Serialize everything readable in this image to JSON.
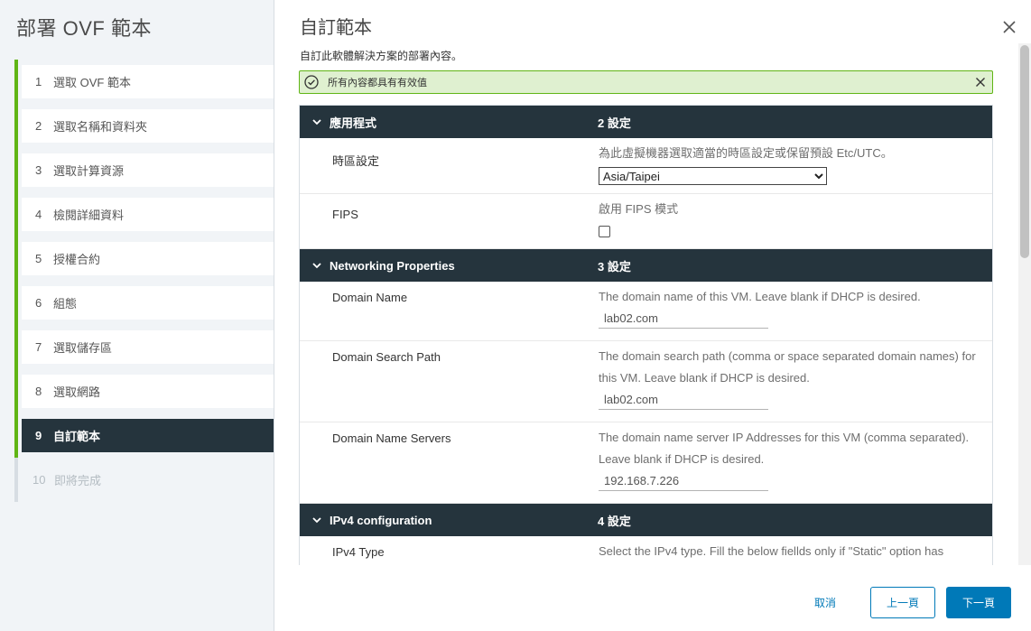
{
  "wizard": {
    "title": "部署 OVF 範本",
    "steps": [
      {
        "num": "1",
        "label": "選取 OVF 範本"
      },
      {
        "num": "2",
        "label": "選取名稱和資料夾"
      },
      {
        "num": "3",
        "label": "選取計算資源"
      },
      {
        "num": "4",
        "label": "檢閱詳細資料"
      },
      {
        "num": "5",
        "label": "授權合約"
      },
      {
        "num": "6",
        "label": "組態"
      },
      {
        "num": "7",
        "label": "選取儲存區"
      },
      {
        "num": "8",
        "label": "選取網路"
      },
      {
        "num": "9",
        "label": "自訂範本"
      },
      {
        "num": "10",
        "label": "即將完成"
      }
    ]
  },
  "page": {
    "title": "自訂範本",
    "subtitle": "自訂此軟體解決方案的部署內容。"
  },
  "alert": {
    "text": "所有內容都具有有效值"
  },
  "sections": {
    "app": {
      "name": "應用程式",
      "count": "2 設定",
      "timezone": {
        "label": "時區設定",
        "description": "為此虛擬機器選取適當的時區設定或保留預設 Etc/UTC。",
        "value": "Asia/Taipei"
      },
      "fips": {
        "label": "FIPS",
        "description": "啟用 FIPS 模式"
      }
    },
    "networking": {
      "name": "Networking Properties",
      "count": "3 設定",
      "domain_name": {
        "label": "Domain Name",
        "description": "The domain name of this VM. Leave blank if DHCP is desired.",
        "value": "lab02.com"
      },
      "domain_search": {
        "label": "Domain Search Path",
        "description": "The domain search path (comma or space separated domain names) for this VM. Leave blank if DHCP is desired.",
        "value": "lab02.com"
      },
      "dns_servers": {
        "label": "Domain Name Servers",
        "description": "The domain name server IP Addresses for this VM (comma separated). Leave blank if DHCP is desired.",
        "value": "192.168.7.226"
      }
    },
    "ipv4": {
      "name": "IPv4 configuration",
      "count": "4 設定",
      "ipv4_type": {
        "label": "IPv4 Type",
        "description": "Select the IPv4 type. Fill the below fiellds only if \"Static\" option has"
      }
    }
  },
  "footer": {
    "cancel": "取消",
    "back": "上一頁",
    "next": "下一頁"
  },
  "colors": {
    "sidebar_bg": "#f1f4f7",
    "step_complete": "#60b515",
    "active_step_bg": "#25343d",
    "section_header_bg": "#25343d",
    "alert_bg": "#dff0d0",
    "primary": "#0079b8"
  }
}
